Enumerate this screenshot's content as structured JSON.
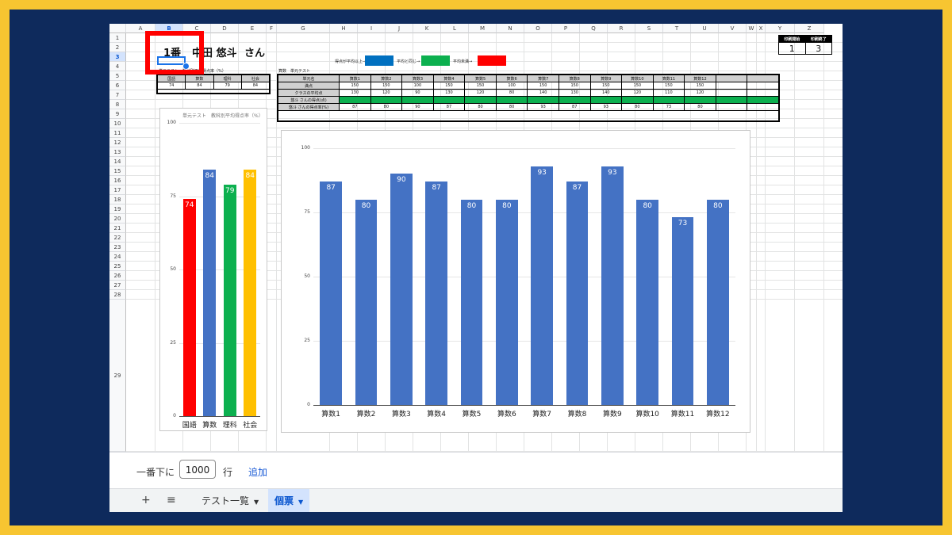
{
  "sheet": {
    "columns": [
      "A",
      "B",
      "C",
      "D",
      "E",
      "F",
      "G",
      "H",
      "I",
      "J",
      "K",
      "L",
      "M",
      "N",
      "O",
      "P",
      "Q",
      "R",
      "S",
      "T",
      "U",
      "V",
      "W",
      "X",
      "Y",
      "Z"
    ],
    "rows": [
      "1",
      "2",
      "3",
      "4",
      "5",
      "6",
      "7",
      "8",
      "9",
      "10",
      "11",
      "12",
      "13",
      "14",
      "15",
      "16",
      "17",
      "18",
      "19",
      "20",
      "21",
      "22",
      "23",
      "24",
      "25",
      "26",
      "27",
      "28",
      "29"
    ],
    "selected_column": "B",
    "selected_row": "3",
    "title": {
      "number": "1番",
      "name": "中田 悠斗",
      "suffix": "さん"
    },
    "legend_row": {
      "above_label": "得点が平均以上→",
      "equal_label": "平均と同じ→",
      "below_label": "平均未満→",
      "above_color": "#0070c0",
      "equal_color": "#0cb04f",
      "below_color": "#ff0000"
    },
    "subject_caption": "単元テスト　教科別平均得点率（%）",
    "subject_table": {
      "headers": [
        "国語",
        "算数",
        "理科",
        "社会"
      ],
      "values": [
        "74",
        "84",
        "79",
        "84"
      ]
    },
    "unit_caption": "算数　単元テスト",
    "unit_table": {
      "row_labels": [
        "単元名",
        "満点",
        "クラスの平均点",
        "悠斗 さんの得点(点)",
        "悠斗 さんの得点率(%)"
      ],
      "units": [
        "算数1",
        "算数2",
        "算数3",
        "算数4",
        "算数5",
        "算数6",
        "算数7",
        "算数8",
        "算数9",
        "算数10",
        "算数11",
        "算数12"
      ],
      "full_marks": [
        "150",
        "150",
        "100",
        "150",
        "150",
        "100",
        "150",
        "150",
        "150",
        "150",
        "150",
        "150"
      ],
      "class_avg": [
        "130",
        "120",
        "90",
        "130",
        "120",
        "80",
        "140",
        "130",
        "140",
        "120",
        "110",
        "120"
      ],
      "rates": [
        "87",
        "80",
        "90",
        "87",
        "80",
        "80",
        "93",
        "87",
        "93",
        "80",
        "73",
        "80"
      ]
    },
    "print_box": {
      "start_label": "印刷開始",
      "end_label": "印刷終了",
      "start_value": "1",
      "end_value": "3"
    }
  },
  "chart_data": [
    {
      "type": "bar",
      "title": "単元テスト　教科別平均得点率（%）",
      "categories": [
        "国語",
        "算数",
        "理科",
        "社会"
      ],
      "values": [
        74,
        84,
        79,
        84
      ],
      "colors": [
        "#ff0000",
        "#4472c4",
        "#0cb04f",
        "#ffc000"
      ],
      "ylim": [
        0,
        100
      ],
      "yticks": [
        "0",
        "25",
        "50",
        "75",
        "100"
      ],
      "data_labels": [
        "74",
        "84",
        "79",
        "84"
      ],
      "grid": true
    },
    {
      "type": "bar",
      "title": "",
      "categories": [
        "算数1",
        "算数2",
        "算数3",
        "算数4",
        "算数5",
        "算数6",
        "算数7",
        "算数8",
        "算数9",
        "算数10",
        "算数11",
        "算数12"
      ],
      "values": [
        87,
        80,
        90,
        87,
        80,
        80,
        93,
        87,
        93,
        80,
        73,
        80
      ],
      "colors": [
        "#4472c4"
      ],
      "ylim": [
        0,
        100
      ],
      "yticks": [
        "0",
        "25",
        "50",
        "75",
        "100"
      ],
      "data_labels": [
        "87",
        "80",
        "90",
        "87",
        "80",
        "80",
        "93",
        "87",
        "93",
        "80",
        "73",
        "80"
      ],
      "grid": true
    }
  ],
  "footer": {
    "prefix": "一番下に",
    "row_count": "1000",
    "unit": "行",
    "add_label": "追加"
  },
  "tabbar": {
    "add_icon": "+",
    "menu_icon": "≡",
    "tabs": [
      {
        "label": "テスト一覧"
      },
      {
        "label": "個票"
      }
    ],
    "active_tab": "個票"
  }
}
